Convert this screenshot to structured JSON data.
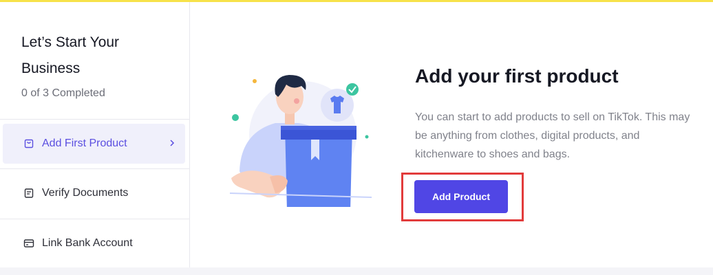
{
  "sidebar": {
    "title": "Let’s Start Your Business",
    "progress": "0 of 3 Completed",
    "items": [
      {
        "label": "Add First Product",
        "icon": "shopping-bag-icon",
        "active": true
      },
      {
        "label": "Verify Documents",
        "icon": "document-icon",
        "active": false
      },
      {
        "label": "Link Bank Account",
        "icon": "credit-card-icon",
        "active": false
      }
    ]
  },
  "main": {
    "title": "Add your first product",
    "description": "You can start to add products to sell on TikTok. This may be anything from clothes, digital products, and kitchenware to shoes and bags.",
    "button_label": "Add Product"
  },
  "colors": {
    "accent": "#5046e5",
    "active_item_bg": "#f0f0fb",
    "highlight": "#e23b3b",
    "top_strip": "#f7e24a"
  }
}
